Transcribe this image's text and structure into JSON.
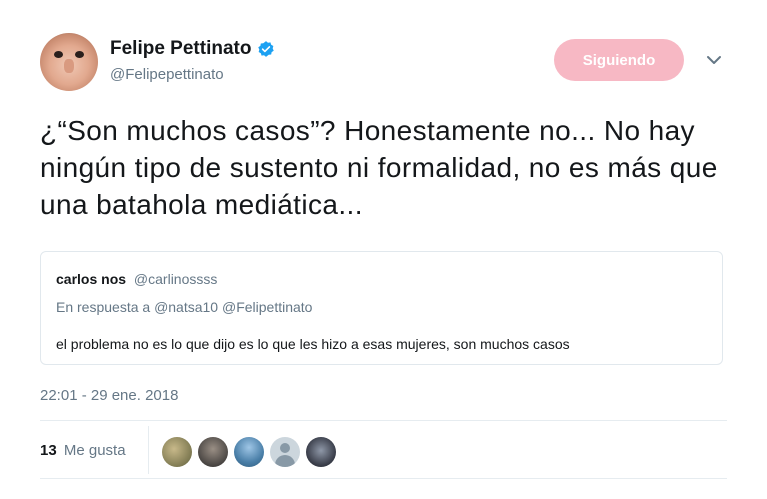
{
  "tweet": {
    "author": {
      "name": "Felipe Pettinato",
      "handle": "@Felipepettinato",
      "verified": true
    },
    "follow_button": {
      "label": "Siguiendo",
      "color": "#f7b8c4"
    },
    "text": "¿“Son muchos casos”? Honestamente no... No hay ningún tipo de sustento ni formalidad, no es más que una batahola mediática...",
    "quoted": {
      "name": "carlos nos",
      "handle": "@carlinossss",
      "reply_prefix": "En respuesta a",
      "reply_to": "@natsa10 @Felipettinato",
      "text": "el problema no es lo que dijo es lo que les hizo a esas mujeres, son muchos casos"
    },
    "timestamp": "22:01 - 29 ene. 2018",
    "likes": {
      "count": "13",
      "label": "Me gusta"
    },
    "icons": {
      "verified": "verified-badge-icon",
      "more": "chevron-down-icon"
    },
    "accent_color": "#1da1f2"
  }
}
